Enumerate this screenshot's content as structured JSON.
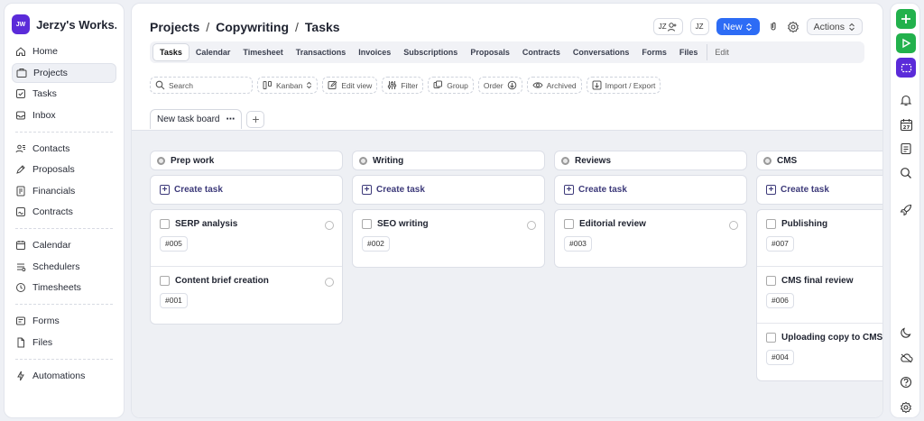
{
  "workspace": {
    "initials": "JW",
    "name": "Jerzy's Works..."
  },
  "sidebar": {
    "groups": [
      [
        {
          "label": "Home",
          "icon": "home-icon"
        },
        {
          "label": "Projects",
          "icon": "projects-icon",
          "active": true
        },
        {
          "label": "Tasks",
          "icon": "tasks-icon"
        },
        {
          "label": "Inbox",
          "icon": "inbox-icon"
        }
      ],
      [
        {
          "label": "Contacts",
          "icon": "contacts-icon"
        },
        {
          "label": "Proposals",
          "icon": "proposals-icon"
        },
        {
          "label": "Financials",
          "icon": "financials-icon"
        },
        {
          "label": "Contracts",
          "icon": "contracts-icon"
        }
      ],
      [
        {
          "label": "Calendar",
          "icon": "calendar-icon"
        },
        {
          "label": "Schedulers",
          "icon": "schedulers-icon"
        },
        {
          "label": "Timesheets",
          "icon": "timesheets-icon"
        }
      ],
      [
        {
          "label": "Forms",
          "icon": "forms-icon"
        },
        {
          "label": "Files",
          "icon": "files-icon"
        }
      ],
      [
        {
          "label": "Automations",
          "icon": "automations-icon"
        }
      ]
    ]
  },
  "breadcrumb": {
    "items": [
      "Projects",
      "Copywriting",
      "Tasks"
    ],
    "separator": "/"
  },
  "header": {
    "assignee_initials": "JZ",
    "user_initials": "JZ",
    "new_label": "New",
    "actions_label": "Actions"
  },
  "tabs": [
    "Tasks",
    "Calendar",
    "Timesheet",
    "Transactions",
    "Invoices",
    "Subscriptions",
    "Proposals",
    "Contracts",
    "Conversations",
    "Forms",
    "Files"
  ],
  "tabs_active": "Tasks",
  "tabs_edit_label": "Edit",
  "toolbar": {
    "search_placeholder": "Search",
    "kanban_label": "Kanban",
    "edit_view_label": "Edit view",
    "filter_label": "Filter",
    "group_label": "Group",
    "order_label": "Order",
    "archived_label": "Archived",
    "import_export_label": "Import / Export"
  },
  "board_tab": {
    "label": "New task board",
    "more": "⋯",
    "add": "+"
  },
  "columns": [
    {
      "name": "Prep work",
      "create_label": "Create task",
      "cards": [
        {
          "title": "SERP analysis",
          "id": "#005"
        },
        {
          "title": "Content brief creation",
          "id": "#001"
        }
      ]
    },
    {
      "name": "Writing",
      "create_label": "Create task",
      "cards": [
        {
          "title": "SEO writing",
          "id": "#002"
        }
      ]
    },
    {
      "name": "Reviews",
      "create_label": "Create task",
      "cards": [
        {
          "title": "Editorial review",
          "id": "#003"
        }
      ]
    },
    {
      "name": "CMS",
      "create_label": "Create task",
      "cards": [
        {
          "title": "Publishing",
          "id": "#007"
        },
        {
          "title": "CMS final review",
          "id": "#006"
        },
        {
          "title": "Uploading copy to CMS",
          "id": "#004"
        }
      ]
    }
  ],
  "rail_icons": [
    "add-icon",
    "play-icon",
    "capture-icon",
    "bell-icon",
    "calendar-27-icon",
    "notes-icon",
    "search-icon",
    "rocket-icon",
    "moon-icon",
    "cloud-icon",
    "help-icon",
    "settings-icon"
  ],
  "rail_calendar_day": "27",
  "colors": {
    "accent": "#2d6cf5",
    "brand": "#5b2bd9",
    "green": "#22b14c"
  }
}
